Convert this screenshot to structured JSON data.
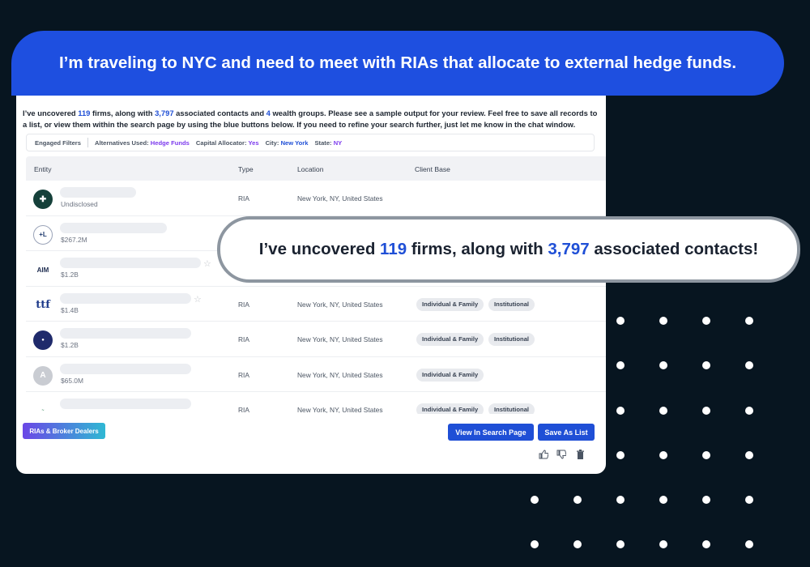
{
  "banner": {
    "text": "I’m traveling to NYC and need to meet with RIAs that allocate to external hedge funds."
  },
  "intro": {
    "prefix": "I’ve uncovered ",
    "firms": "119",
    "mid1": " firms, along with ",
    "contacts": "3,797",
    "mid2": " associated contacts and ",
    "groups": "4",
    "suffix": " wealth groups. Please see a sample output for your review. Feel free to save all records to a list, or view them within the search page by using the blue buttons below. If you need to refine your search further, just let me know in the chat window."
  },
  "filters": {
    "label": "Engaged Filters",
    "alt_label": "Alternatives Used:",
    "alt_value": "Hedge Funds",
    "cap_label": "Capital Allocator:",
    "cap_value": "Yes",
    "city_label": "City:",
    "city_value": "New York",
    "state_label": "State:",
    "state_value": "NY"
  },
  "table": {
    "headers": {
      "entity": "Entity",
      "type": "Type",
      "location": "Location",
      "client": "Client Base"
    },
    "rows": [
      {
        "aum": "Undisclosed",
        "type": "RIA",
        "location": "New York, NY, United States",
        "tags": []
      },
      {
        "aum": "$267.2M",
        "type": "",
        "location": "",
        "tags": []
      },
      {
        "aum": "$1.2B",
        "type": "",
        "location": "",
        "tags": []
      },
      {
        "aum": "$1.4B",
        "type": "RIA",
        "location": "New York, NY, United States",
        "tags": [
          "Individual & Family",
          "Institutional"
        ]
      },
      {
        "aum": "$1.2B",
        "type": "RIA",
        "location": "New York, NY, United States",
        "tags": [
          "Individual & Family",
          "Institutional"
        ]
      },
      {
        "aum": "$65.0M",
        "type": "RIA",
        "location": "New York, NY, United States",
        "tags": [
          "Individual & Family"
        ]
      },
      {
        "aum": "",
        "type": "RIA",
        "location": "New York, NY, United States",
        "tags": [
          "Individual & Family",
          "Institutional"
        ]
      }
    ],
    "avatar_letter": "A"
  },
  "buttons": {
    "ria": "RIAs & Broker Dealers",
    "view": "View In Search Page",
    "save": "Save As List"
  },
  "callout": {
    "prefix": "I’ve uncovered ",
    "firms": "119",
    "mid": " firms, along with ",
    "contacts": "3,797",
    "suffix": " associated contacts!"
  },
  "colors": {
    "accent": "#1f4fd6",
    "background": "#071520",
    "filter_value": "#7c3aed"
  },
  "icons": {
    "like": "thumbs-up-icon",
    "dislike": "thumbs-down-icon",
    "delete": "trash-icon",
    "favorite": "star-icon"
  }
}
